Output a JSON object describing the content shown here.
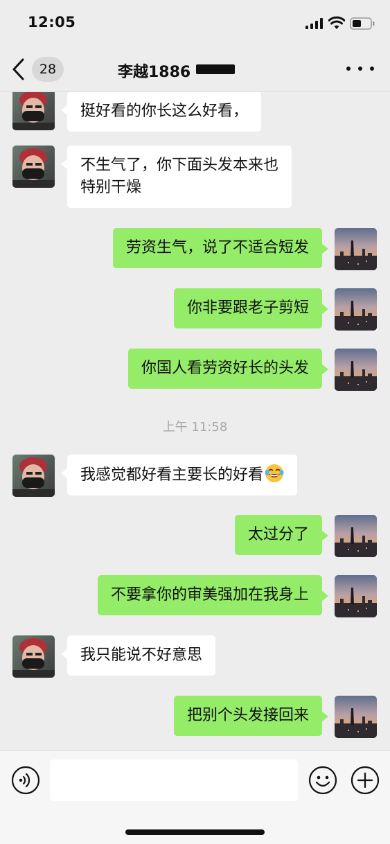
{
  "status_bar": {
    "time": "12:05"
  },
  "nav": {
    "unread_count": "28",
    "title": "李越1886"
  },
  "messages": [
    {
      "side": "in",
      "text": "挺好看的你长这么好看，"
    },
    {
      "side": "in",
      "text": "不生气了，你下面头发本来也\n特别干燥"
    },
    {
      "side": "out",
      "text": "劳资生气，说了不适合短发"
    },
    {
      "side": "out",
      "text": "你非要跟老子剪短"
    },
    {
      "side": "out",
      "text": "你国人看劳资好长的头发"
    },
    {
      "type": "time",
      "text": "上午 11:58"
    },
    {
      "side": "in",
      "text": "我感觉都好看主要长的好看",
      "emoji": "face-with-tears-of-joy"
    },
    {
      "side": "out",
      "text": "太过分了"
    },
    {
      "side": "out",
      "text": "不要拿你的审美强加在我身上"
    },
    {
      "side": "in",
      "text": "我只能说不好意思"
    },
    {
      "side": "out",
      "text": "把别个头发接回来"
    }
  ],
  "input_bar": {
    "placeholder": ""
  },
  "icons": {
    "back": "chevron-left-icon",
    "more": "more-dots-icon",
    "voice": "voice-icon",
    "emoji": "emoji-icon",
    "plus": "plus-icon"
  },
  "colors": {
    "background": "#ededed",
    "outgoing_bubble": "#95ec69",
    "incoming_bubble": "#ffffff",
    "timestamp": "#a8a8a8"
  }
}
